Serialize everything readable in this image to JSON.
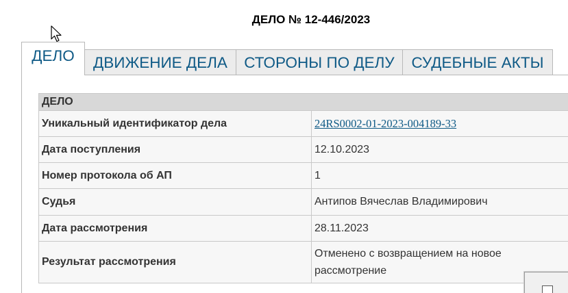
{
  "page": {
    "title": "ДЕЛО № 12-446/2023"
  },
  "tabs": [
    {
      "label": "ДЕЛО",
      "active": true
    },
    {
      "label": "ДВИЖЕНИЕ ДЕЛА",
      "active": false
    },
    {
      "label": "СТОРОНЫ ПО ДЕЛУ",
      "active": false
    },
    {
      "label": "СУДЕБНЫЕ АКТЫ",
      "active": false
    }
  ],
  "case_table": {
    "section_title": "ДЕЛО",
    "rows": [
      {
        "label": "Уникальный идентификатор дела",
        "value": "24RS0002-01-2023-004189-33"
      },
      {
        "label": "Дата поступления",
        "value": "12.10.2023"
      },
      {
        "label": "Номер протокола об АП",
        "value": "1"
      },
      {
        "label": "Судья",
        "value": "Антипов Вячеслав Владимирович"
      },
      {
        "label": "Дата рассмотрения",
        "value": "28.11.2023"
      },
      {
        "label": "Результат рассмотрения",
        "value_line1": "Отменено с возвращением на новое",
        "value_line2": "рассмотрение"
      }
    ]
  },
  "colors": {
    "link": "#0f5a86",
    "tab_text": "#0f5a86",
    "header_bg": "#d8d8d8",
    "cell_bg": "#f7f7f7",
    "border": "#c8c8c8"
  },
  "icons": {
    "cursor": "mouse-pointer-icon"
  }
}
